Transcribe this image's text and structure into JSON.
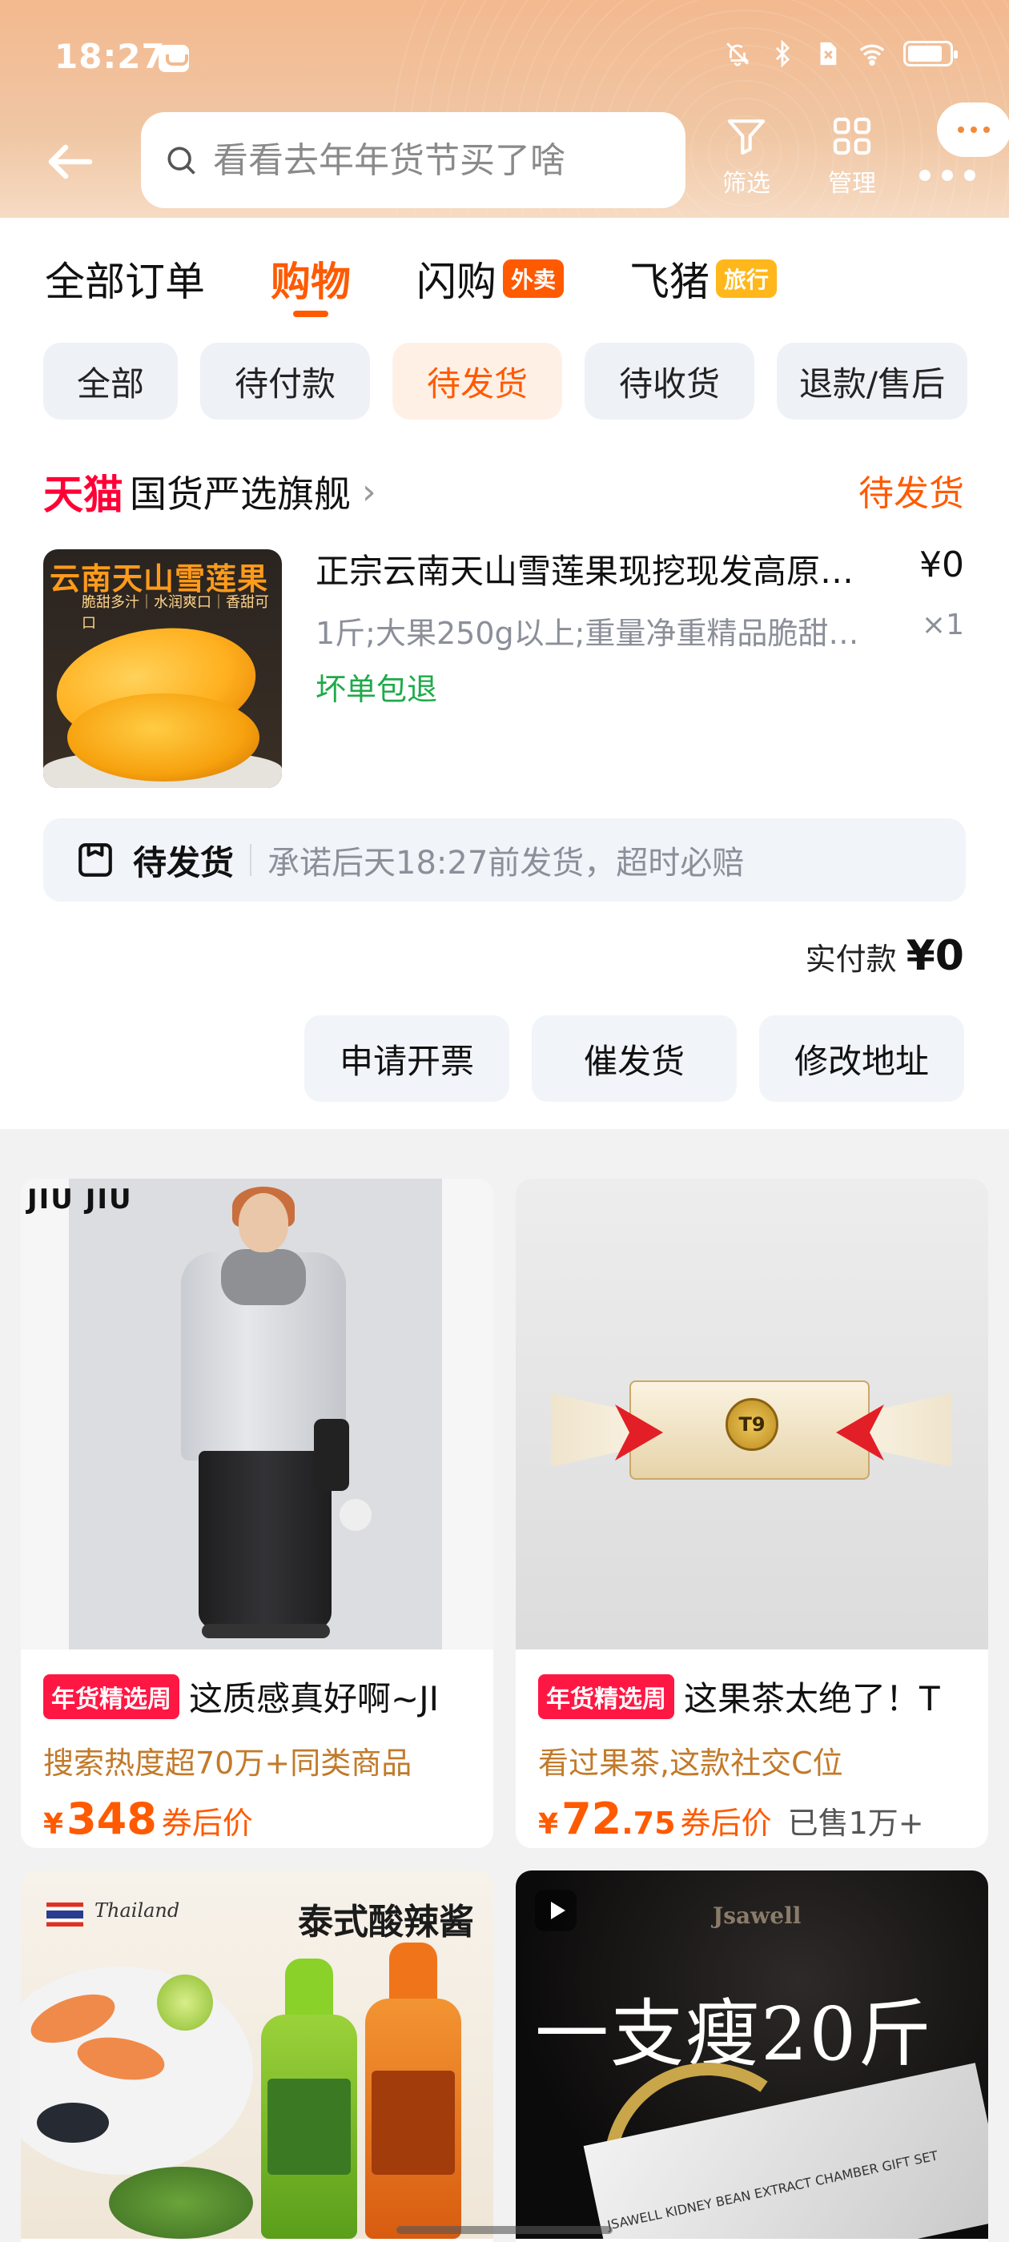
{
  "status_bar": {
    "time": "18:27",
    "icons": [
      "app-icon",
      "mute-icon",
      "bluetooth-icon",
      "sim-icon",
      "wifi-icon",
      "battery-icon"
    ]
  },
  "header": {
    "search_placeholder": "看看去年年货节买了啥",
    "filter_label": "筛选",
    "manage_label": "管理"
  },
  "top_tabs": [
    {
      "label": "全部订单",
      "active": false
    },
    {
      "label": "购物",
      "active": true
    },
    {
      "label": "闪购",
      "badge": "外卖"
    },
    {
      "label": "飞猪",
      "badge": "旅行"
    }
  ],
  "filters": [
    "全部",
    "待付款",
    "待发货",
    "待收货",
    "退款/售后"
  ],
  "active_filter": "待发货",
  "order": {
    "brand": "天猫",
    "shop_name": "国货严选旗舰",
    "status": "待发货",
    "product_image_title": "云南天山雪莲果",
    "product_image_subtitle": "脆甜多汁｜水润爽口｜香甜可口",
    "product_title": "正宗云南天山雪莲果现挖现发高原…",
    "price": "¥0",
    "sku": "1斤;大果250g以上;重量净重精品脆甜…",
    "quantity": "×1",
    "guarantee": "坏单包退",
    "ship_label": "待发货",
    "ship_text": "承诺后天18:27前发货，超时必赔",
    "paid_label": "实付款",
    "paid_value": "¥0",
    "actions": [
      "申请开票",
      "催发货",
      "修改地址"
    ]
  },
  "recommendations": [
    {
      "brand_mark": "JIU JIU",
      "tag": "年货精选周",
      "title": "这质感真好啊~JI",
      "subtitle": "搜索热度超70万+同类商品",
      "price_symbol": "¥",
      "price_int": "348",
      "price_dec": "",
      "coupon": "券后价",
      "sold": ""
    },
    {
      "medal_text": "T9",
      "tag": "年货精选周",
      "title": "这果茶太绝了！T",
      "subtitle": "看过果茶,这款社交C位",
      "price_symbol": "¥",
      "price_int": "72",
      "price_dec": ".75",
      "coupon": "券后价",
      "sold": "已售1万+"
    },
    {
      "country": "Thailand",
      "image_title": "泰式酸辣酱"
    },
    {
      "brand": "Jsawell",
      "headline": "一支瘦20斤",
      "box_text": "JSAWELL  KIDNEY BEAN EXTRACT CHAMBER GIFT SET"
    }
  ],
  "colors": {
    "accent": "#ff5a00",
    "tmall_red": "#ff0036",
    "green": "#1faa4a",
    "tag_red": "#ff1744",
    "header_peach": "#f3b98f"
  }
}
